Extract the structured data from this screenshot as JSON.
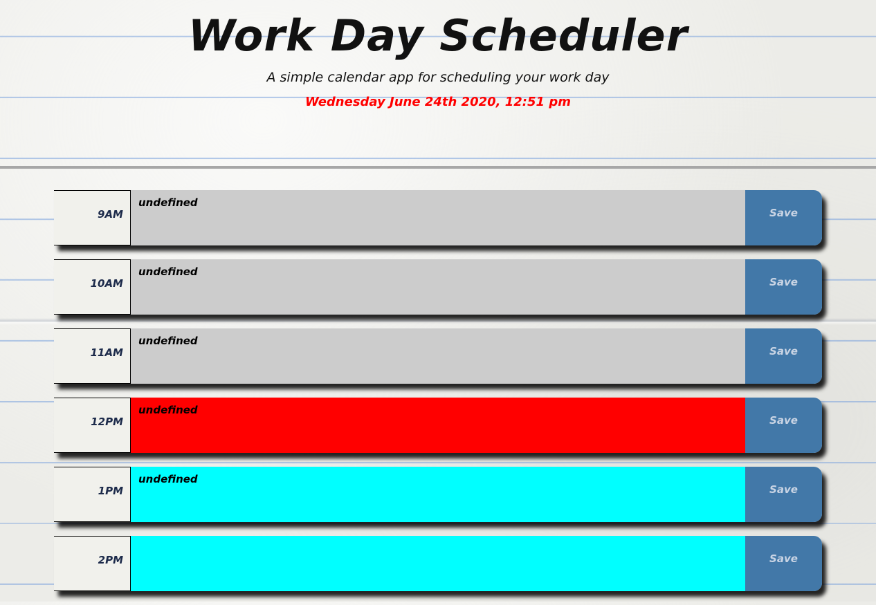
{
  "header": {
    "title": "Work Day Scheduler",
    "subtitle": "A simple calendar app for scheduling your work day",
    "current_day": "Wednesday June 24th 2020, 12:51 pm"
  },
  "time_blocks": [
    {
      "hour": "9AM",
      "text": "undefined",
      "state": "past",
      "save_label": "Save"
    },
    {
      "hour": "10AM",
      "text": "undefined",
      "state": "past",
      "save_label": "Save"
    },
    {
      "hour": "11AM",
      "text": "undefined",
      "state": "past",
      "save_label": "Save"
    },
    {
      "hour": "12PM",
      "text": "undefined",
      "state": "present",
      "save_label": "Save"
    },
    {
      "hour": "1PM",
      "text": "undefined",
      "state": "future",
      "save_label": "Save"
    },
    {
      "hour": "2PM",
      "text": "",
      "state": "future",
      "save_label": "Save"
    }
  ],
  "colors": {
    "past": "#cccccc",
    "present": "#ff0000",
    "future": "#00ffff",
    "save_button": "#4278a8",
    "current_day_text": "#ff0000"
  }
}
